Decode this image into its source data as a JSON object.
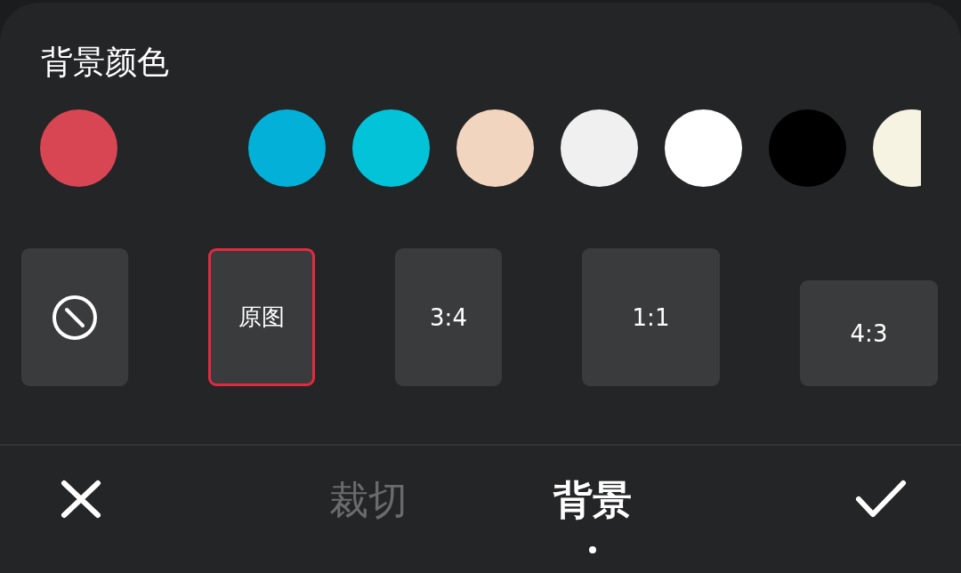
{
  "panel": {
    "title": "背景颜色"
  },
  "colors": [
    {
      "color": "#d84553"
    },
    {
      "color": "#03b0d8"
    },
    {
      "color": "#03c3d9"
    },
    {
      "color": "#f2d5bf"
    },
    {
      "color": "#f0f0f0"
    },
    {
      "color": "#ffffff"
    },
    {
      "color": "#000000"
    },
    {
      "color": "#f7f3e3"
    }
  ],
  "ratios": [
    {
      "kind": "none",
      "selected": false
    },
    {
      "kind": "portrait",
      "label": "原图",
      "selected": true
    },
    {
      "kind": "portrait",
      "label": "3:4",
      "selected": false
    },
    {
      "kind": "square",
      "label": "1:1",
      "selected": false
    },
    {
      "kind": "landscape",
      "label": "4:3",
      "selected": false
    }
  ],
  "bottom_bar": {
    "tabs": [
      {
        "label": "裁切",
        "selected": false
      },
      {
        "label": "背景",
        "selected": true
      }
    ]
  }
}
